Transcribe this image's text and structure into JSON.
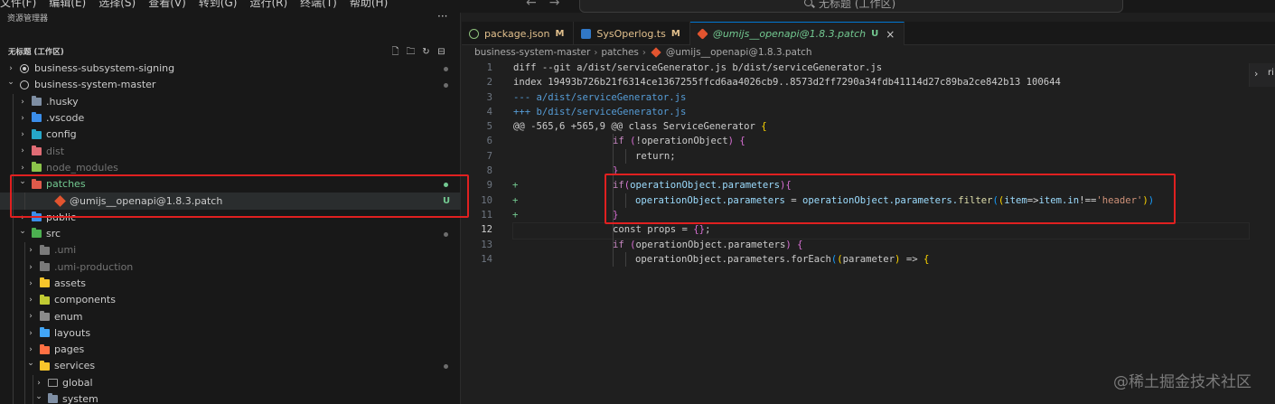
{
  "menu": [
    "文件(F)",
    "编辑(E)",
    "选择(S)",
    "查看(V)",
    "转到(G)",
    "运行(R)",
    "终端(T)",
    "帮助(H)"
  ],
  "nav": {
    "back": "←",
    "forward": "→"
  },
  "command_center": {
    "text": "无标题 (工作区)"
  },
  "explorer": {
    "title": "资源管理器",
    "more": "···",
    "workspace_title": "无标题 (工作区)",
    "actions": [
      "new-file-icon",
      "new-folder-icon",
      "refresh-icon",
      "collapse-all-icon"
    ]
  },
  "tree": [
    {
      "label": "business-subsystem-signing",
      "depth": 0,
      "chevron": "›",
      "icon": "ring-filled",
      "style": "normal",
      "status": "dot"
    },
    {
      "label": "business-system-master",
      "depth": 0,
      "chevron": "⌄",
      "icon": "ring",
      "style": "normal",
      "status": "dot"
    },
    {
      "label": ".husky",
      "depth": 1,
      "chevron": "›",
      "icon": "folder",
      "color": "#7e8ea3",
      "style": "normal",
      "status": ""
    },
    {
      "label": ".vscode",
      "depth": 1,
      "chevron": "›",
      "icon": "folder",
      "color": "#3b8eea",
      "style": "normal",
      "status": ""
    },
    {
      "label": "config",
      "depth": 1,
      "chevron": "›",
      "icon": "folder",
      "color": "#26a7c9",
      "style": "normal",
      "status": ""
    },
    {
      "label": "dist",
      "depth": 1,
      "chevron": "›",
      "icon": "folder",
      "color": "#e06c75",
      "style": "dim",
      "status": ""
    },
    {
      "label": "node_modules",
      "depth": 1,
      "chevron": "›",
      "icon": "folder",
      "color": "#8bc34a",
      "style": "dim",
      "status": ""
    },
    {
      "label": "patches",
      "depth": 1,
      "chevron": "⌄",
      "icon": "folder",
      "color": "#e05a4b",
      "style": "git",
      "status": "dot-green"
    },
    {
      "label": "@umijs__openapi@1.8.3.patch",
      "depth": 2,
      "chevron": "",
      "icon": "diamond",
      "style": "git",
      "status": "U",
      "selected": true
    },
    {
      "label": "public",
      "depth": 1,
      "chevron": "›",
      "icon": "folder",
      "color": "#3b8eea",
      "style": "normal",
      "status": ""
    },
    {
      "label": "src",
      "depth": 1,
      "chevron": "⌄",
      "icon": "folder",
      "color": "#4caf50",
      "style": "normal",
      "status": "dot"
    },
    {
      "label": ".umi",
      "depth": 2,
      "chevron": "›",
      "icon": "folder",
      "color": "#7a7a7a",
      "style": "dim",
      "status": ""
    },
    {
      "label": ".umi-production",
      "depth": 2,
      "chevron": "›",
      "icon": "folder",
      "color": "#7a7a7a",
      "style": "dim",
      "status": ""
    },
    {
      "label": "assets",
      "depth": 2,
      "chevron": "›",
      "icon": "folder",
      "color": "#f7c52b",
      "style": "normal",
      "status": ""
    },
    {
      "label": "components",
      "depth": 2,
      "chevron": "›",
      "icon": "folder",
      "color": "#c0ca33",
      "style": "normal",
      "status": ""
    },
    {
      "label": "enum",
      "depth": 2,
      "chevron": "›",
      "icon": "folder",
      "color": "#8a8a8a",
      "style": "normal",
      "status": ""
    },
    {
      "label": "layouts",
      "depth": 2,
      "chevron": "›",
      "icon": "folder",
      "color": "#42a5f5",
      "style": "normal",
      "status": ""
    },
    {
      "label": "pages",
      "depth": 2,
      "chevron": "›",
      "icon": "folder",
      "color": "#ff7043",
      "style": "normal",
      "status": ""
    },
    {
      "label": "services",
      "depth": 2,
      "chevron": "⌄",
      "icon": "folder",
      "color": "#f7c52b",
      "style": "normal",
      "status": "dot"
    },
    {
      "label": "global",
      "depth": 3,
      "chevron": "›",
      "icon": "folder-outline",
      "color": "#9d9d9d",
      "style": "normal",
      "status": ""
    },
    {
      "label": "system",
      "depth": 3,
      "chevron": "⌄",
      "icon": "folder",
      "color": "#7e8ea3",
      "style": "normal",
      "status": ""
    }
  ],
  "tabs": [
    {
      "label": "package.json",
      "mod": "M",
      "icon": "npm-icon",
      "color": "#cb3837",
      "active": false
    },
    {
      "label": "SysOperlog.ts",
      "mod": "M",
      "icon": "ts-icon",
      "color": "#3178c6",
      "active": false
    },
    {
      "label": "@umijs__openapi@1.8.3.patch",
      "mod": "U",
      "icon": "git-diamond-icon",
      "color": "#e2542f",
      "active": true,
      "close": "×"
    }
  ],
  "breadcrumb": [
    "business-system-master",
    "patches",
    "@umijs__openapi@1.8.3.patch"
  ],
  "code": [
    {
      "n": "1",
      "g": "",
      "indent": 0,
      "tokens": [
        [
          "c-hdr",
          "diff --git a/dist/serviceGenerator.js b/dist/serviceGenerator.js"
        ]
      ]
    },
    {
      "n": "2",
      "g": "",
      "indent": 0,
      "tokens": [
        [
          "c-hdr",
          "index 19493b726b21f6314ce1367255ffcd6aa4026cb9..8573d2ff7290a34fdb41114d27c89ba2ce842b13 100644"
        ]
      ]
    },
    {
      "n": "3",
      "g": "",
      "indent": 0,
      "tokens": [
        [
          "c-old",
          "--- a/dist/serviceGenerator.js"
        ]
      ]
    },
    {
      "n": "4",
      "g": "",
      "indent": 0,
      "tokens": [
        [
          "c-new",
          "+++ b/dist/serviceGenerator.js"
        ]
      ]
    },
    {
      "n": "5",
      "g": "",
      "indent": 0,
      "tokens": [
        [
          "c-txt",
          "@@ -565,6 +565,9 @@ class ServiceGenerator "
        ],
        [
          "c-br3",
          "{"
        ]
      ]
    },
    {
      "n": "6",
      "g": "",
      "indent": 2,
      "tokens": [
        [
          "c-kw",
          "if"
        ],
        [
          "c-txt",
          " "
        ],
        [
          "c-br1",
          "("
        ],
        [
          "c-txt",
          "!operationObject"
        ],
        [
          "c-br1",
          ")"
        ],
        [
          "c-txt",
          " "
        ],
        [
          "c-br1",
          "{"
        ]
      ]
    },
    {
      "n": "7",
      "g": "",
      "indent": 3,
      "tokens": [
        [
          "c-txt",
          "return;"
        ]
      ]
    },
    {
      "n": "8",
      "g": "",
      "indent": 2,
      "tokens": [
        [
          "c-br1",
          "}"
        ]
      ]
    },
    {
      "n": "9",
      "g": "+",
      "indent": 2,
      "tokens": [
        [
          "c-kw",
          "if"
        ],
        [
          "c-br1",
          "("
        ],
        [
          "c-var",
          "operationObject.parameters"
        ],
        [
          "c-br1",
          ")"
        ],
        [
          "c-br1",
          "{"
        ]
      ]
    },
    {
      "n": "10",
      "g": "+",
      "indent": 3,
      "tokens": [
        [
          "c-var",
          "operationObject.parameters"
        ],
        [
          "c-txt",
          " = "
        ],
        [
          "c-var",
          "operationObject.parameters."
        ],
        [
          "c-fn",
          "filter"
        ],
        [
          "c-br2",
          "("
        ],
        [
          "c-br3",
          "("
        ],
        [
          "c-var",
          "item"
        ],
        [
          "c-op",
          "=>"
        ],
        [
          "c-var",
          "item.in"
        ],
        [
          "c-op",
          "!=="
        ],
        [
          "c-str",
          "'header'"
        ],
        [
          "c-br3",
          ")"
        ],
        [
          "c-br2",
          ")"
        ]
      ]
    },
    {
      "n": "11",
      "g": "+",
      "indent": 2,
      "tokens": [
        [
          "c-br1",
          "}"
        ]
      ]
    },
    {
      "n": "12",
      "g": "",
      "indent": 2,
      "cur": true,
      "tokens": [
        [
          "c-txt",
          "const props = "
        ],
        [
          "c-br1",
          "{}"
        ],
        [
          "c-txt",
          ";"
        ]
      ]
    },
    {
      "n": "13",
      "g": "",
      "indent": 2,
      "tokens": [
        [
          "c-kw",
          "if"
        ],
        [
          "c-txt",
          " "
        ],
        [
          "c-br1",
          "("
        ],
        [
          "c-txt",
          "operationObject.parameters"
        ],
        [
          "c-br1",
          ")"
        ],
        [
          "c-txt",
          " "
        ],
        [
          "c-br1",
          "{"
        ]
      ]
    },
    {
      "n": "14",
      "g": "",
      "indent": 3,
      "tokens": [
        [
          "c-txt",
          "operationObject.parameters.forEach"
        ],
        [
          "c-br2",
          "("
        ],
        [
          "c-br3",
          "("
        ],
        [
          "c-txt",
          "parameter"
        ],
        [
          "c-br3",
          ")"
        ],
        [
          "c-txt",
          " => "
        ],
        [
          "c-br3",
          "{"
        ]
      ]
    }
  ],
  "right_panel": {
    "chevron": "›",
    "text": "ri"
  },
  "watermark": "@稀土掘金技术社区"
}
